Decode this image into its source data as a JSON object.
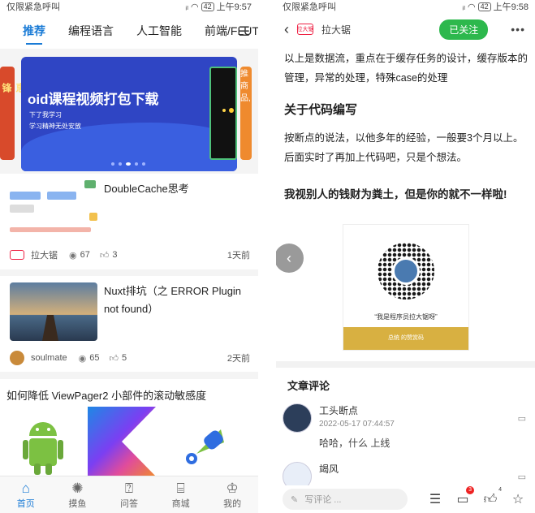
{
  "left": {
    "status": {
      "carrier": "仅限紧急呼叫",
      "battery": "42",
      "time": "上午9:57"
    },
    "tabs": [
      {
        "label": "推荐",
        "active": true
      },
      {
        "label": "编程语言"
      },
      {
        "label": "人工智能"
      },
      {
        "label": "前端/FLUT"
      }
    ],
    "banner": {
      "side_left_text": "锋",
      "side_left_text2": "恵",
      "title": "oid课程视频打包下载",
      "line1": "下了我学习",
      "line2": "学习精神无处安放",
      "side_right_text": "推商",
      "side_right_text2": "品,"
    },
    "articles": [
      {
        "title": "DoubleCache思考",
        "author": "拉大锯",
        "views": "67",
        "likes": "3",
        "time": "1天前"
      },
      {
        "title": "Nuxt排坑（之 ERROR Plugin not found）",
        "author": "soulmate",
        "views": "65",
        "likes": "5",
        "time": "2天前"
      },
      {
        "title": "如何降低 ViewPager2 小部件的滚动敏感度"
      }
    ],
    "nav": [
      {
        "label": "首页",
        "icon": "home-icon",
        "active": true
      },
      {
        "label": "摸鱼",
        "icon": "fish-icon"
      },
      {
        "label": "问答",
        "icon": "question-icon"
      },
      {
        "label": "商城",
        "icon": "shop-icon"
      },
      {
        "label": "我的",
        "icon": "profile-icon"
      }
    ],
    "colors": {
      "accent": "#1a7bd6"
    }
  },
  "right": {
    "status": {
      "carrier": "仅限紧急呼叫",
      "battery": "42",
      "time": "上午9:58"
    },
    "header": {
      "logo": "拉大锯",
      "author": "拉大锯",
      "follow_label": "已关注"
    },
    "article": {
      "p1": "以上是数据流，重点在于缓存任务的设计，缓存版本的管理，异常的处理，特殊case的处理",
      "h2": "关于代码编写",
      "p2": "按断点的说法，以他多年的经验，一般要3个月以上。后面实时了再加上代码吧，只是个想法。",
      "bold": "我视别人的钱财为粪土，但是你的就不一样啦!",
      "qr_caption": "“我是程序员拉大锯呀”",
      "qr_bar": "总统 的赞赏码"
    },
    "comments": {
      "title": "文章评论",
      "items": [
        {
          "name": "工头断点",
          "time": "2022-05-17 07:44:57",
          "text": "哈哈，什么 上线"
        },
        {
          "name": "竭风"
        }
      ]
    },
    "bottom": {
      "input_placeholder": "写评论 ...",
      "comment_count": "3",
      "like_count": "4"
    },
    "colors": {
      "follow": "#2db84d"
    }
  }
}
